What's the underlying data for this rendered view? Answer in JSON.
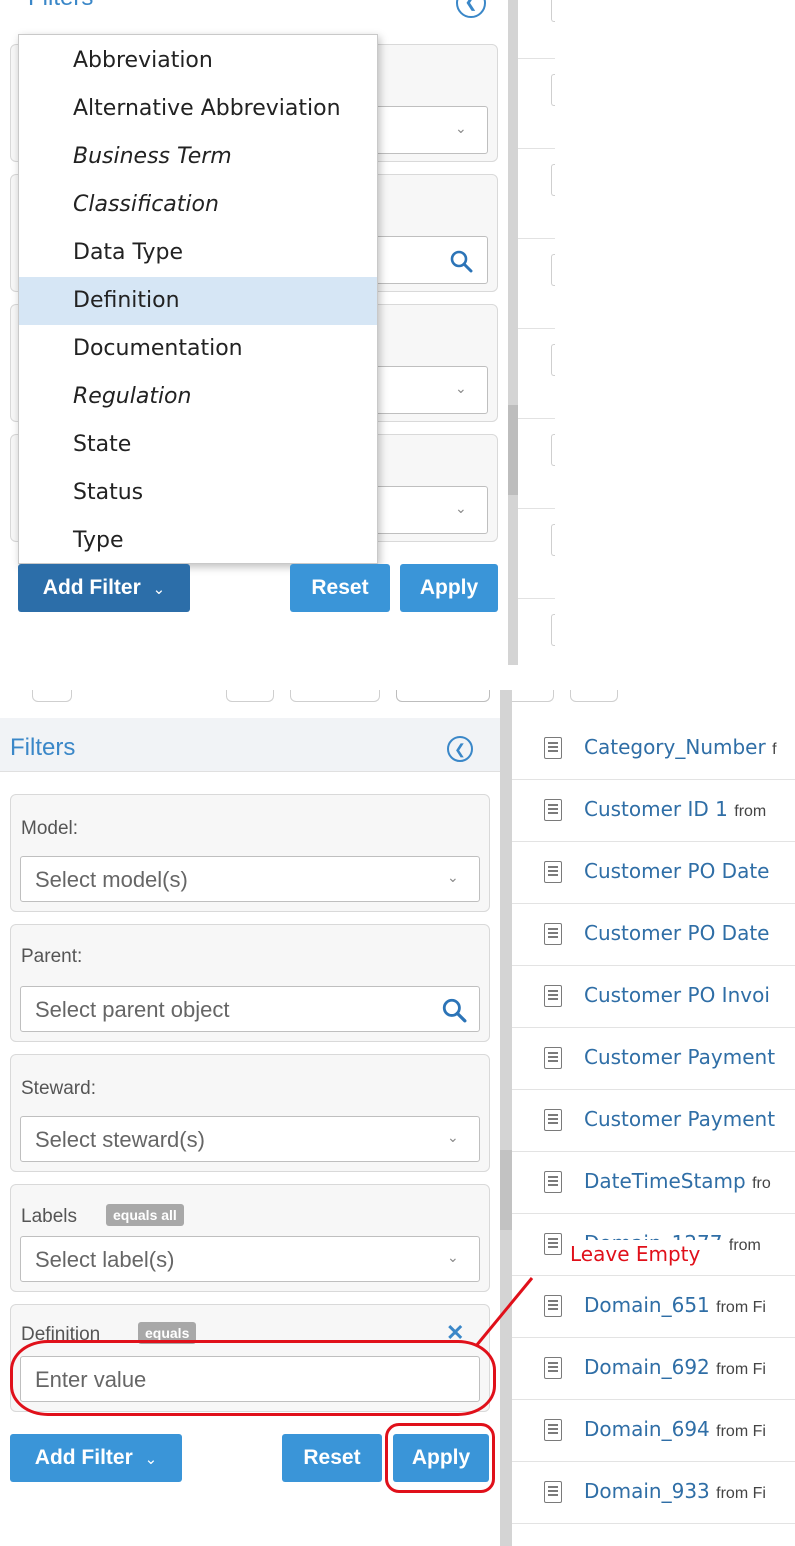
{
  "top_panel": {
    "heading": "Filters",
    "dropdown_items": [
      {
        "label": "Abbreviation",
        "italic": false,
        "highlighted": false
      },
      {
        "label": "Alternative Abbreviation",
        "italic": false,
        "highlighted": false
      },
      {
        "label": "Business Term",
        "italic": true,
        "highlighted": false
      },
      {
        "label": "Classification",
        "italic": true,
        "highlighted": false
      },
      {
        "label": "Data Type",
        "italic": false,
        "highlighted": false
      },
      {
        "label": "Definition",
        "italic": false,
        "highlighted": true
      },
      {
        "label": "Documentation",
        "italic": false,
        "highlighted": false
      },
      {
        "label": "Regulation",
        "italic": true,
        "highlighted": false
      },
      {
        "label": "State",
        "italic": false,
        "highlighted": false
      },
      {
        "label": "Status",
        "italic": false,
        "highlighted": false
      },
      {
        "label": "Type",
        "italic": false,
        "highlighted": false
      }
    ],
    "add_filter_label": "Add Filter",
    "reset_label": "Reset",
    "apply_label": "Apply"
  },
  "bottom_panel": {
    "heading": "Filters",
    "model": {
      "label": "Model:",
      "placeholder": "Select model(s)"
    },
    "parent": {
      "label": "Parent:",
      "placeholder": "Select parent object"
    },
    "steward": {
      "label": "Steward:",
      "placeholder": "Select steward(s)"
    },
    "labels": {
      "label": "Labels",
      "badge": "equals all",
      "placeholder": "Select label(s)"
    },
    "definition": {
      "label": "Definition",
      "badge": "equals",
      "placeholder": "Enter value",
      "value": ""
    },
    "add_filter_label": "Add Filter",
    "reset_label": "Reset",
    "apply_label": "Apply",
    "annotation": "Leave Empty",
    "results": [
      {
        "name": "Category_Number",
        "suffix": "f"
      },
      {
        "name": "Customer ID 1",
        "suffix": "from"
      },
      {
        "name": "Customer PO Date",
        "suffix": ""
      },
      {
        "name": "Customer PO Date",
        "suffix": ""
      },
      {
        "name": "Customer PO Invoi",
        "suffix": ""
      },
      {
        "name": "Customer Payment",
        "suffix": ""
      },
      {
        "name": "Customer Payment",
        "suffix": ""
      },
      {
        "name": "DateTimeStamp",
        "suffix": "fro"
      },
      {
        "name": "Domain_1277",
        "suffix": "from"
      },
      {
        "name": "Domain_651",
        "suffix": "from Fi"
      },
      {
        "name": "Domain_692",
        "suffix": "from Fi"
      },
      {
        "name": "Domain_694",
        "suffix": "from Fi"
      },
      {
        "name": "Domain_933",
        "suffix": "from Fi"
      }
    ]
  },
  "colors": {
    "accent": "#3a87c8",
    "button_dark": "#2c6ea9",
    "button_blue": "#3a95d8",
    "highlight": "#d6e6f5",
    "annotation_red": "#e0101a"
  }
}
